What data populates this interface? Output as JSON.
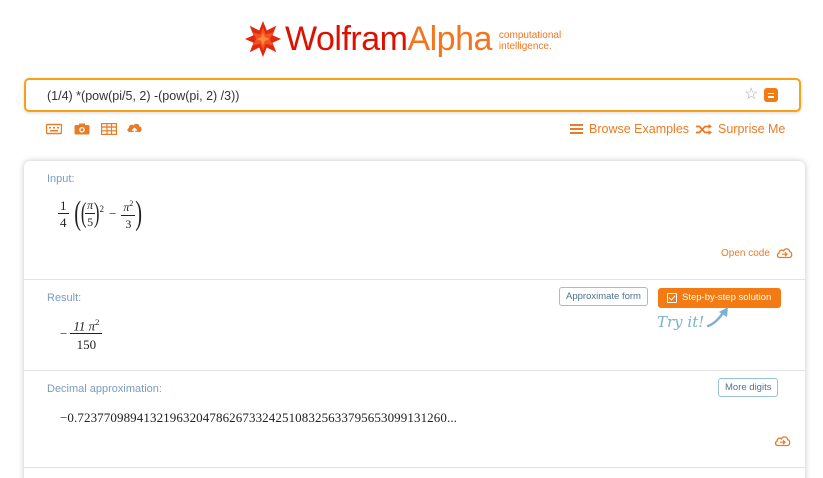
{
  "logo": {
    "wolfram": "Wolfram",
    "alpha": "Alpha",
    "tagline_1": "computational",
    "tagline_2": "intelligence."
  },
  "search": {
    "query": "(1/4) *(pow(pi/5, 2) -(pow(pi, 2) /3))"
  },
  "toolbar": {
    "icons": [
      "keyboard-icon",
      "camera-icon",
      "table-icon",
      "upload-icon"
    ],
    "browse_examples": "Browse Examples",
    "surprise_me": "Surprise Me"
  },
  "pods": {
    "input": {
      "title": "Input:",
      "open_code": "Open code",
      "math": {
        "coef_num": "1",
        "coef_den": "4",
        "a_num": "π",
        "a_den": "5",
        "a_exp": "2",
        "minus": "−",
        "b_num": "π",
        "b_exp": "2",
        "b_den": "3"
      }
    },
    "result": {
      "title": "Result:",
      "approximate_form": "Approximate form",
      "step_by_step": "Step-by-step solution",
      "try_it": "Try it!",
      "math": {
        "sign": "−",
        "num": "11 π",
        "num_exp": "2",
        "den": "150"
      }
    },
    "decimal": {
      "title": "Decimal approximation:",
      "more_digits": "More digits",
      "value": "−0.72377098941321963204786267332425108325633795653099131260..."
    }
  },
  "colors": {
    "accent_orange": "#f47a13",
    "logo_red": "#dd1100",
    "pod_title_blue": "#7a9bbf",
    "button_border_blue": "#9ac0d4"
  }
}
